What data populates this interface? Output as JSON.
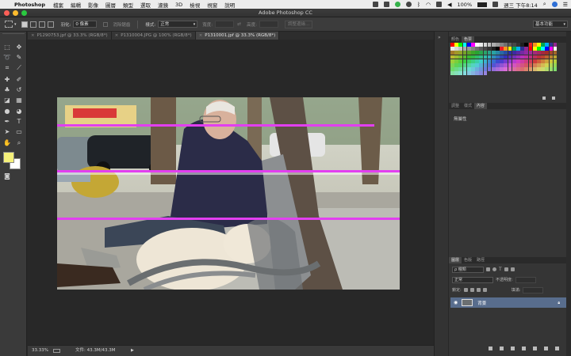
{
  "menubar": {
    "app_name": "Photoshop",
    "items": [
      "檔案",
      "編輯",
      "影像",
      "圖層",
      "類型",
      "選取",
      "濾鏡",
      "3D",
      "檢視",
      "視窗",
      "說明"
    ],
    "battery": "100%",
    "clock": "週三 下午8:14"
  },
  "window": {
    "title": "Adobe Photoshop CC"
  },
  "options_bar": {
    "feather_label": "羽化:",
    "feather_value": "0 像素",
    "antialias_label": "消除鋸齒",
    "style_label": "樣式:",
    "style_value": "正常",
    "width_label": "寬度:",
    "height_label": "高度:",
    "refine_edge_label": "調整邊緣...",
    "workspace": "基本功能"
  },
  "tabs": [
    {
      "label": "P1290753.jpf @ 33.3% (RGB/8*)",
      "active": false
    },
    {
      "label": "P1310004.JPG @ 100% (RGB/8*)",
      "active": false
    },
    {
      "label": "P1310001.jpf @ 33.3% (RGB/8*)",
      "active": true
    }
  ],
  "status": {
    "zoom": "33.33%",
    "doc": "文件: 43.3M/43.3M"
  },
  "panels": {
    "top_tabs": [
      "顏色",
      "色票"
    ],
    "mid_tabs": [
      "調整",
      "樣式",
      "內容"
    ],
    "properties_title": "無屬性",
    "layer_tabs": [
      "圖層",
      "色版",
      "路徑"
    ],
    "kind_filter": "ρ 種類",
    "blend_mode": "正常",
    "opacity_label": "不透明度:",
    "lock_label": "鎖定:",
    "fill_label": "填滿:",
    "layer_name": "背景"
  },
  "colors": {
    "foreground": "#f5f07a",
    "background": "#ffffff",
    "layer_selected": "#586d8d",
    "artifact_line": "#e23ff0"
  }
}
